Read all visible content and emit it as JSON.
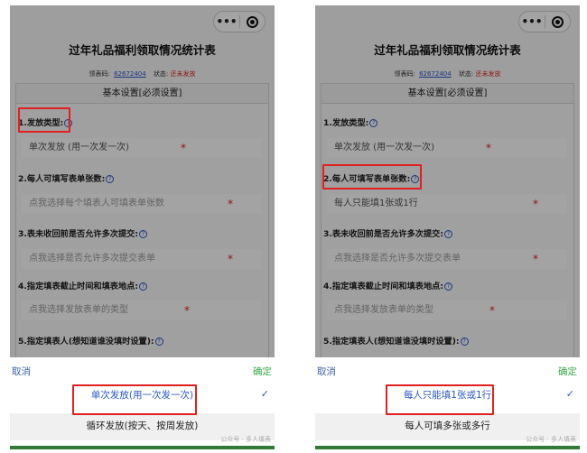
{
  "screens": [
    {
      "capsule": {
        "more_icon": "more-dots-icon",
        "close_icon": "target-icon"
      },
      "title": "过年礼品福利领取情况统计表",
      "meta": {
        "code_label": "领表码:",
        "code": "62672404",
        "status_label": "状态:",
        "status": "还未发放"
      },
      "section_title": "基本设置[必须设置]",
      "fields": [
        {
          "label": "1.发放类型:",
          "value": "单次发放 (用一次发一次)",
          "placeholder": false
        },
        {
          "label": "2.每人可填写表单张数:",
          "value": "点我选择每个填表人可填表单张数",
          "placeholder": true
        },
        {
          "label": "3.表未收回前是否允许多次提交:",
          "value": "点我选择是否允许多次提交表单",
          "placeholder": true
        },
        {
          "label": "4.指定填表截止时间和填表地点:",
          "value": "点我选择发放表单的类型",
          "placeholder": true
        },
        {
          "label": "5.指定填表人(想知道谁没填时设置):",
          "value": "",
          "placeholder": true
        }
      ],
      "picker": {
        "cancel": "取消",
        "confirm": "确定",
        "selected": "单次发放(用一次发一次)",
        "next": "循环发放(按天、按周发放)",
        "watermark": "公众号 · 多人填表"
      }
    },
    {
      "capsule": {
        "more_icon": "more-dots-icon",
        "close_icon": "target-icon"
      },
      "title": "过年礼品福利领取情况统计表",
      "meta": {
        "code_label": "领表码:",
        "code": "62672404",
        "status_label": "状态:",
        "status": "还未发放"
      },
      "section_title": "基本设置[必须设置]",
      "fields": [
        {
          "label": "1.发放类型:",
          "value": "单次发放 (用一次发一次)",
          "placeholder": false
        },
        {
          "label": "2.每人可填写表单张数:",
          "value": "每人只能填1张或1行",
          "placeholder": false
        },
        {
          "label": "3.表未收回前是否允许多次提交:",
          "value": "点我选择是否允许多次提交表单",
          "placeholder": true
        },
        {
          "label": "4.指定填表截止时间和填表地点:",
          "value": "点我选择发放表单的类型",
          "placeholder": true
        },
        {
          "label": "5.指定填表人(想知道谁没填时设置):",
          "value": "",
          "placeholder": true
        }
      ],
      "picker": {
        "cancel": "取消",
        "confirm": "确定",
        "selected": "每人只能填1张或1行",
        "next": "每人可填多张或多行",
        "watermark": "公众号 · 多人填表"
      }
    }
  ]
}
